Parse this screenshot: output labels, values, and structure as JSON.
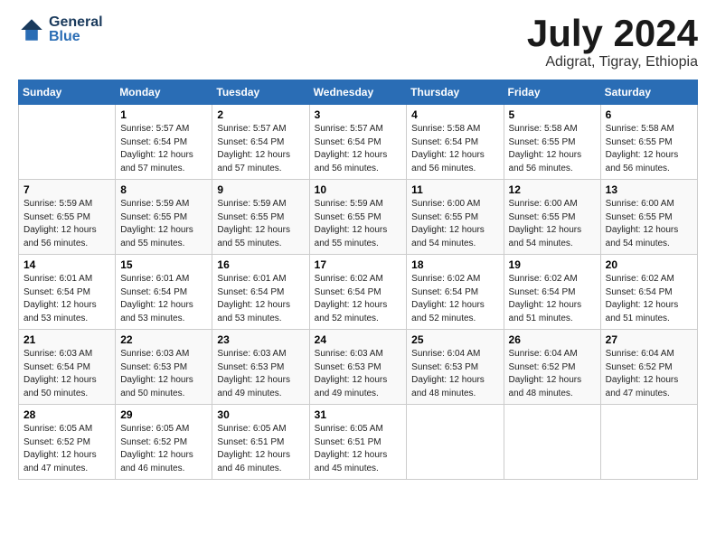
{
  "logo": {
    "line1": "General",
    "line2": "Blue"
  },
  "title": "July 2024",
  "subtitle": "Adigrat, Tigray, Ethiopia",
  "weekdays": [
    "Sunday",
    "Monday",
    "Tuesday",
    "Wednesday",
    "Thursday",
    "Friday",
    "Saturday"
  ],
  "weeks": [
    [
      {
        "num": "",
        "info": ""
      },
      {
        "num": "1",
        "info": "Sunrise: 5:57 AM\nSunset: 6:54 PM\nDaylight: 12 hours\nand 57 minutes."
      },
      {
        "num": "2",
        "info": "Sunrise: 5:57 AM\nSunset: 6:54 PM\nDaylight: 12 hours\nand 57 minutes."
      },
      {
        "num": "3",
        "info": "Sunrise: 5:57 AM\nSunset: 6:54 PM\nDaylight: 12 hours\nand 56 minutes."
      },
      {
        "num": "4",
        "info": "Sunrise: 5:58 AM\nSunset: 6:54 PM\nDaylight: 12 hours\nand 56 minutes."
      },
      {
        "num": "5",
        "info": "Sunrise: 5:58 AM\nSunset: 6:55 PM\nDaylight: 12 hours\nand 56 minutes."
      },
      {
        "num": "6",
        "info": "Sunrise: 5:58 AM\nSunset: 6:55 PM\nDaylight: 12 hours\nand 56 minutes."
      }
    ],
    [
      {
        "num": "7",
        "info": "Sunrise: 5:59 AM\nSunset: 6:55 PM\nDaylight: 12 hours\nand 56 minutes."
      },
      {
        "num": "8",
        "info": "Sunrise: 5:59 AM\nSunset: 6:55 PM\nDaylight: 12 hours\nand 55 minutes."
      },
      {
        "num": "9",
        "info": "Sunrise: 5:59 AM\nSunset: 6:55 PM\nDaylight: 12 hours\nand 55 minutes."
      },
      {
        "num": "10",
        "info": "Sunrise: 5:59 AM\nSunset: 6:55 PM\nDaylight: 12 hours\nand 55 minutes."
      },
      {
        "num": "11",
        "info": "Sunrise: 6:00 AM\nSunset: 6:55 PM\nDaylight: 12 hours\nand 54 minutes."
      },
      {
        "num": "12",
        "info": "Sunrise: 6:00 AM\nSunset: 6:55 PM\nDaylight: 12 hours\nand 54 minutes."
      },
      {
        "num": "13",
        "info": "Sunrise: 6:00 AM\nSunset: 6:55 PM\nDaylight: 12 hours\nand 54 minutes."
      }
    ],
    [
      {
        "num": "14",
        "info": "Sunrise: 6:01 AM\nSunset: 6:54 PM\nDaylight: 12 hours\nand 53 minutes."
      },
      {
        "num": "15",
        "info": "Sunrise: 6:01 AM\nSunset: 6:54 PM\nDaylight: 12 hours\nand 53 minutes."
      },
      {
        "num": "16",
        "info": "Sunrise: 6:01 AM\nSunset: 6:54 PM\nDaylight: 12 hours\nand 53 minutes."
      },
      {
        "num": "17",
        "info": "Sunrise: 6:02 AM\nSunset: 6:54 PM\nDaylight: 12 hours\nand 52 minutes."
      },
      {
        "num": "18",
        "info": "Sunrise: 6:02 AM\nSunset: 6:54 PM\nDaylight: 12 hours\nand 52 minutes."
      },
      {
        "num": "19",
        "info": "Sunrise: 6:02 AM\nSunset: 6:54 PM\nDaylight: 12 hours\nand 51 minutes."
      },
      {
        "num": "20",
        "info": "Sunrise: 6:02 AM\nSunset: 6:54 PM\nDaylight: 12 hours\nand 51 minutes."
      }
    ],
    [
      {
        "num": "21",
        "info": "Sunrise: 6:03 AM\nSunset: 6:54 PM\nDaylight: 12 hours\nand 50 minutes."
      },
      {
        "num": "22",
        "info": "Sunrise: 6:03 AM\nSunset: 6:53 PM\nDaylight: 12 hours\nand 50 minutes."
      },
      {
        "num": "23",
        "info": "Sunrise: 6:03 AM\nSunset: 6:53 PM\nDaylight: 12 hours\nand 49 minutes."
      },
      {
        "num": "24",
        "info": "Sunrise: 6:03 AM\nSunset: 6:53 PM\nDaylight: 12 hours\nand 49 minutes."
      },
      {
        "num": "25",
        "info": "Sunrise: 6:04 AM\nSunset: 6:53 PM\nDaylight: 12 hours\nand 48 minutes."
      },
      {
        "num": "26",
        "info": "Sunrise: 6:04 AM\nSunset: 6:52 PM\nDaylight: 12 hours\nand 48 minutes."
      },
      {
        "num": "27",
        "info": "Sunrise: 6:04 AM\nSunset: 6:52 PM\nDaylight: 12 hours\nand 47 minutes."
      }
    ],
    [
      {
        "num": "28",
        "info": "Sunrise: 6:05 AM\nSunset: 6:52 PM\nDaylight: 12 hours\nand 47 minutes."
      },
      {
        "num": "29",
        "info": "Sunrise: 6:05 AM\nSunset: 6:52 PM\nDaylight: 12 hours\nand 46 minutes."
      },
      {
        "num": "30",
        "info": "Sunrise: 6:05 AM\nSunset: 6:51 PM\nDaylight: 12 hours\nand 46 minutes."
      },
      {
        "num": "31",
        "info": "Sunrise: 6:05 AM\nSunset: 6:51 PM\nDaylight: 12 hours\nand 45 minutes."
      },
      {
        "num": "",
        "info": ""
      },
      {
        "num": "",
        "info": ""
      },
      {
        "num": "",
        "info": ""
      }
    ]
  ]
}
